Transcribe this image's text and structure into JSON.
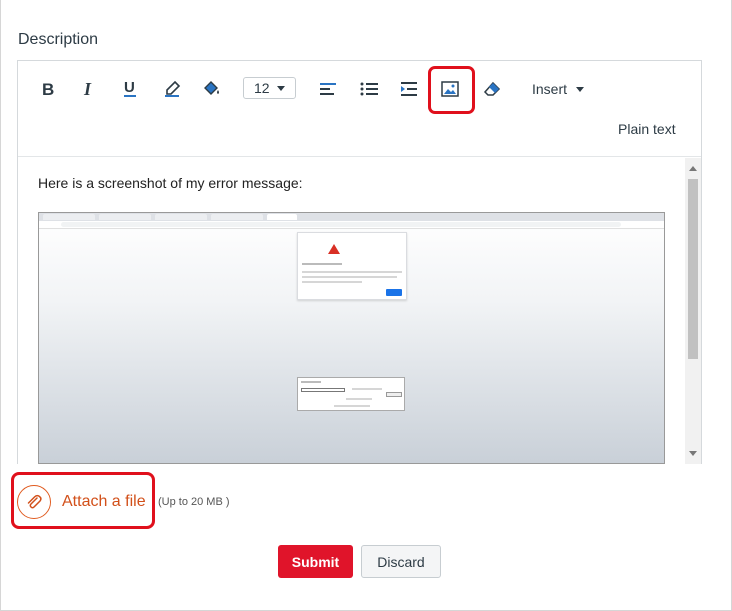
{
  "form": {
    "description_label": "Description"
  },
  "toolbar": {
    "font_size": "12",
    "insert_label": "Insert",
    "plain_text_label": "Plain text",
    "icons": [
      "bold-icon",
      "italic-icon",
      "underline-icon",
      "text-color-icon",
      "background-color-icon",
      "align-left-icon",
      "bulleted-list-icon",
      "indent-icon",
      "image-icon",
      "eraser-icon"
    ]
  },
  "content": {
    "text": "Here is a screenshot of my error message:"
  },
  "attach": {
    "link_label": "Attach a file",
    "size_note": "(Up to 20 MB )"
  },
  "actions": {
    "submit_label": "Submit",
    "discard_label": "Discard"
  },
  "colors": {
    "accent_orange": "#d2501a",
    "highlight_red": "#e0101c",
    "submit_red": "#e0142a",
    "icon_blue": "#2a74c3"
  }
}
